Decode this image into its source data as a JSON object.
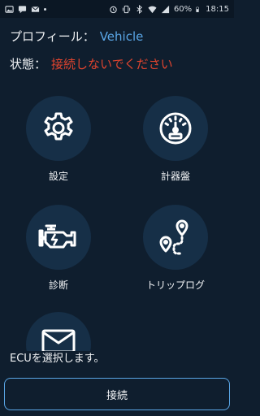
{
  "status_bar": {
    "battery": "60%",
    "time": "18:15",
    "left_icons": [
      "image-icon",
      "message-icon",
      "mail-icon",
      "dot-icon"
    ],
    "right_icons": [
      "alarm-icon",
      "vibrate-icon",
      "bluetooth-icon",
      "wifi-icon",
      "signal-icon",
      "battery-icon"
    ]
  },
  "profile": {
    "label": "プロフィール：",
    "value": "Vehicle"
  },
  "state": {
    "label": "状態：",
    "value": "接続しないでください"
  },
  "tiles": [
    {
      "label": "設定",
      "icon": "gear-icon"
    },
    {
      "label": "計器盤",
      "icon": "speedometer-icon"
    },
    {
      "label": "診断",
      "icon": "engine-icon"
    },
    {
      "label": "トリップログ",
      "icon": "route-icon"
    },
    {
      "label": "",
      "icon": "envelope-icon"
    }
  ],
  "message": "ECUを選択します。",
  "connect_button": "接続",
  "colors": {
    "background": "#0f1e2e",
    "accent": "#5aa6e6",
    "error": "#e0442e",
    "tile_circle": "#162f47"
  }
}
